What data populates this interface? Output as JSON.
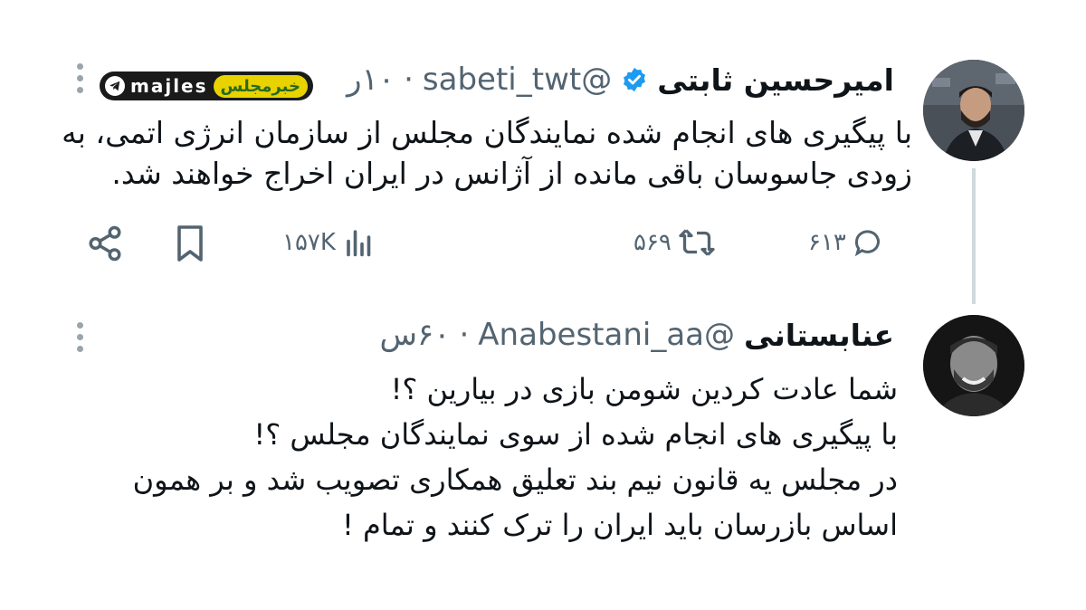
{
  "watermark": {
    "label_en": "majles",
    "label_fa": "خبرمجلس"
  },
  "tweet1": {
    "author_name": "امیرحسین ثابتی",
    "handle": "@sabeti_twt",
    "time": "۱۰ر",
    "text_lines": [
      "با پیگیری های انجام شده نمایندگان مجلس از سازمان انرژی اتمی، به",
      "زودی جاسوسان باقی مانده از آژانس در ایران اخراج خواهند شد."
    ],
    "actions": {
      "replies": "۶۱۳",
      "retweets": "۵۶۹",
      "views": "۱۵۷K"
    }
  },
  "tweet2": {
    "author_name": "عنابستانی",
    "handle": "@Anabestani_aa",
    "time": "۶۰س",
    "text_lines": [
      "شما عادت کردین شومن بازی در بیارین ؟!",
      "با پیگیری های انجام شده از سوی نمایندگان مجلس ؟!",
      "در مجلس یه قانون نیم بند تعلیق همکاری تصویب  شد و بر همون",
      "اساس بازرسان باید ایران را ترک کنند و  تمام !"
    ]
  },
  "colors": {
    "verified": "#1d9bf0",
    "muted": "#536471",
    "thread_line": "#cfd9de"
  }
}
